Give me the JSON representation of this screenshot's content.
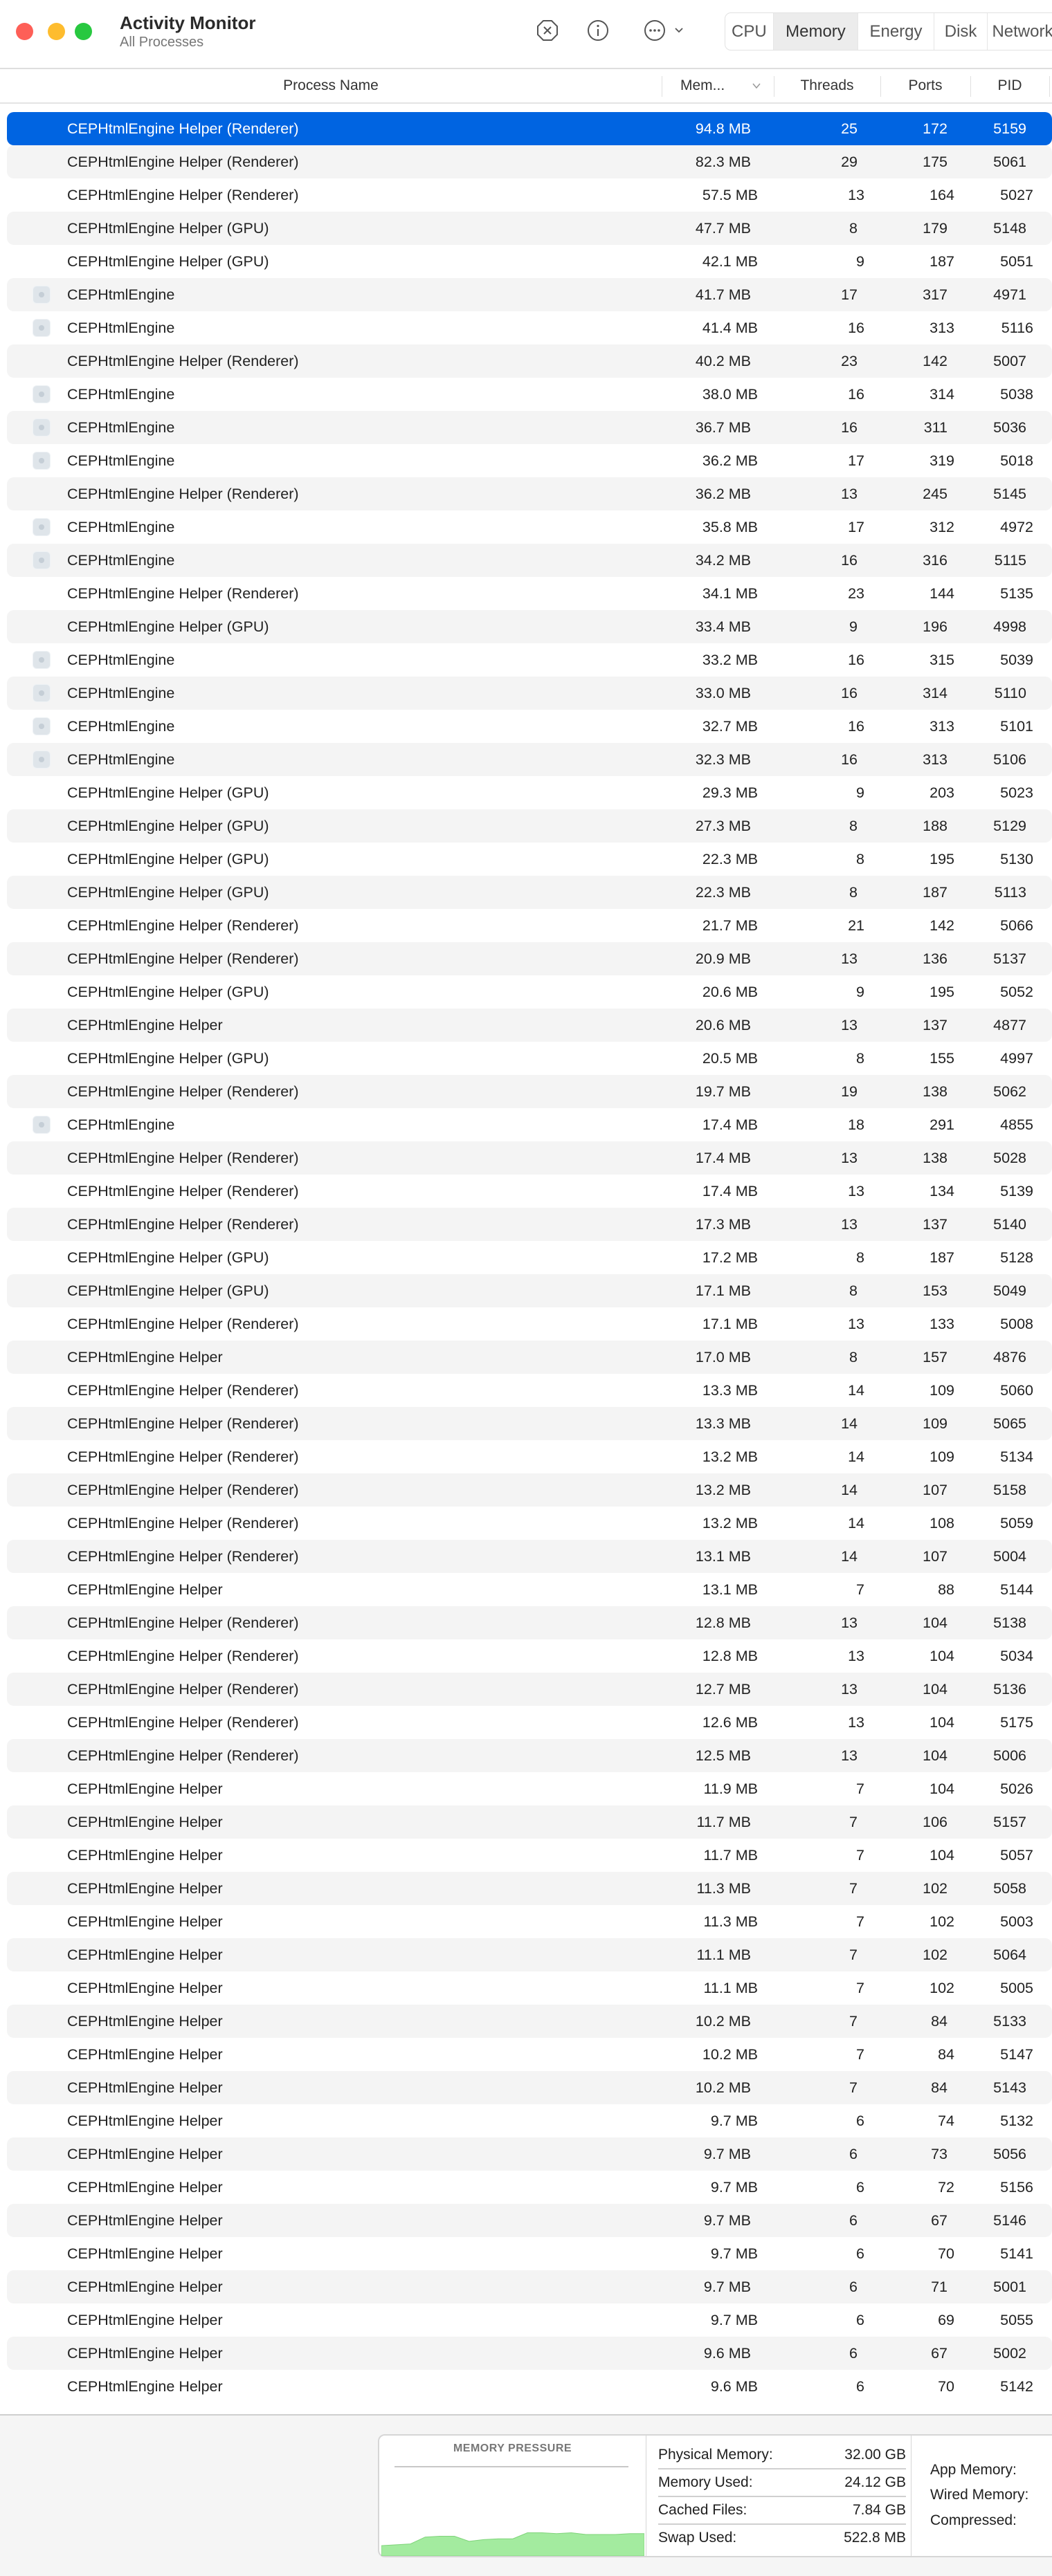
{
  "window": {
    "title": "Activity Monitor",
    "subtitle": "All Processes"
  },
  "traffic_lights": {
    "close": "#fe5f57",
    "minimize": "#febc2e",
    "zoom": "#28c840"
  },
  "toolbar": {
    "icons": [
      "stop-process-icon",
      "info-icon",
      "more-actions-icon",
      "chevron-down-icon"
    ],
    "tabs": [
      {
        "label": "CPU",
        "active": false
      },
      {
        "label": "Memory",
        "active": true
      },
      {
        "label": "Energy",
        "active": false
      },
      {
        "label": "Disk",
        "active": false
      },
      {
        "label": "Network",
        "active": false
      }
    ]
  },
  "table": {
    "columns": {
      "name": "Process Name",
      "memory": "Mem...",
      "threads": "Threads",
      "ports": "Ports",
      "pid": "PID"
    },
    "sort_column": "memory",
    "sort_direction": "descending",
    "selected_color": "#0064e1",
    "rows": [
      {
        "name": "CEPHtmlEngine Helper (Renderer)",
        "memory": "94.8 MB",
        "threads": "25",
        "ports": "172",
        "pid": "5159",
        "selected": true
      },
      {
        "name": "CEPHtmlEngine Helper (Renderer)",
        "memory": "82.3 MB",
        "threads": "29",
        "ports": "175",
        "pid": "5061"
      },
      {
        "name": "CEPHtmlEngine Helper (Renderer)",
        "memory": "57.5 MB",
        "threads": "13",
        "ports": "164",
        "pid": "5027"
      },
      {
        "name": "CEPHtmlEngine Helper (GPU)",
        "memory": "47.7 MB",
        "threads": "8",
        "ports": "179",
        "pid": "5148"
      },
      {
        "name": "CEPHtmlEngine Helper (GPU)",
        "memory": "42.1 MB",
        "threads": "9",
        "ports": "187",
        "pid": "5051"
      },
      {
        "name": "CEPHtmlEngine",
        "memory": "41.7 MB",
        "threads": "17",
        "ports": "317",
        "pid": "4971",
        "icon": "app-icon"
      },
      {
        "name": "CEPHtmlEngine",
        "memory": "41.4 MB",
        "threads": "16",
        "ports": "313",
        "pid": "5116",
        "icon": "app-icon"
      },
      {
        "name": "CEPHtmlEngine Helper (Renderer)",
        "memory": "40.2 MB",
        "threads": "23",
        "ports": "142",
        "pid": "5007"
      },
      {
        "name": "CEPHtmlEngine",
        "memory": "38.0 MB",
        "threads": "16",
        "ports": "314",
        "pid": "5038",
        "icon": "app-icon"
      },
      {
        "name": "CEPHtmlEngine",
        "memory": "36.7 MB",
        "threads": "16",
        "ports": "311",
        "pid": "5036",
        "icon": "app-icon"
      },
      {
        "name": "CEPHtmlEngine",
        "memory": "36.2 MB",
        "threads": "17",
        "ports": "319",
        "pid": "5018",
        "icon": "app-icon"
      },
      {
        "name": "CEPHtmlEngine Helper (Renderer)",
        "memory": "36.2 MB",
        "threads": "13",
        "ports": "245",
        "pid": "5145"
      },
      {
        "name": "CEPHtmlEngine",
        "memory": "35.8 MB",
        "threads": "17",
        "ports": "312",
        "pid": "4972",
        "icon": "app-icon"
      },
      {
        "name": "CEPHtmlEngine",
        "memory": "34.2 MB",
        "threads": "16",
        "ports": "316",
        "pid": "5115",
        "icon": "app-icon"
      },
      {
        "name": "CEPHtmlEngine Helper (Renderer)",
        "memory": "34.1 MB",
        "threads": "23",
        "ports": "144",
        "pid": "5135"
      },
      {
        "name": "CEPHtmlEngine Helper (GPU)",
        "memory": "33.4 MB",
        "threads": "9",
        "ports": "196",
        "pid": "4998"
      },
      {
        "name": "CEPHtmlEngine",
        "memory": "33.2 MB",
        "threads": "16",
        "ports": "315",
        "pid": "5039",
        "icon": "app-icon"
      },
      {
        "name": "CEPHtmlEngine",
        "memory": "33.0 MB",
        "threads": "16",
        "ports": "314",
        "pid": "5110",
        "icon": "app-icon"
      },
      {
        "name": "CEPHtmlEngine",
        "memory": "32.7 MB",
        "threads": "16",
        "ports": "313",
        "pid": "5101",
        "icon": "app-icon"
      },
      {
        "name": "CEPHtmlEngine",
        "memory": "32.3 MB",
        "threads": "16",
        "ports": "313",
        "pid": "5106",
        "icon": "app-icon"
      },
      {
        "name": "CEPHtmlEngine Helper (GPU)",
        "memory": "29.3 MB",
        "threads": "9",
        "ports": "203",
        "pid": "5023"
      },
      {
        "name": "CEPHtmlEngine Helper (GPU)",
        "memory": "27.3 MB",
        "threads": "8",
        "ports": "188",
        "pid": "5129"
      },
      {
        "name": "CEPHtmlEngine Helper (GPU)",
        "memory": "22.3 MB",
        "threads": "8",
        "ports": "195",
        "pid": "5130"
      },
      {
        "name": "CEPHtmlEngine Helper (GPU)",
        "memory": "22.3 MB",
        "threads": "8",
        "ports": "187",
        "pid": "5113"
      },
      {
        "name": "CEPHtmlEngine Helper (Renderer)",
        "memory": "21.7 MB",
        "threads": "21",
        "ports": "142",
        "pid": "5066"
      },
      {
        "name": "CEPHtmlEngine Helper (Renderer)",
        "memory": "20.9 MB",
        "threads": "13",
        "ports": "136",
        "pid": "5137"
      },
      {
        "name": "CEPHtmlEngine Helper (GPU)",
        "memory": "20.6 MB",
        "threads": "9",
        "ports": "195",
        "pid": "5052"
      },
      {
        "name": "CEPHtmlEngine Helper",
        "memory": "20.6 MB",
        "threads": "13",
        "ports": "137",
        "pid": "4877"
      },
      {
        "name": "CEPHtmlEngine Helper (GPU)",
        "memory": "20.5 MB",
        "threads": "8",
        "ports": "155",
        "pid": "4997"
      },
      {
        "name": "CEPHtmlEngine Helper (Renderer)",
        "memory": "19.7 MB",
        "threads": "19",
        "ports": "138",
        "pid": "5062"
      },
      {
        "name": "CEPHtmlEngine",
        "memory": "17.4 MB",
        "threads": "18",
        "ports": "291",
        "pid": "4855",
        "icon": "app-icon"
      },
      {
        "name": "CEPHtmlEngine Helper (Renderer)",
        "memory": "17.4 MB",
        "threads": "13",
        "ports": "138",
        "pid": "5028"
      },
      {
        "name": "CEPHtmlEngine Helper (Renderer)",
        "memory": "17.4 MB",
        "threads": "13",
        "ports": "134",
        "pid": "5139"
      },
      {
        "name": "CEPHtmlEngine Helper (Renderer)",
        "memory": "17.3 MB",
        "threads": "13",
        "ports": "137",
        "pid": "5140"
      },
      {
        "name": "CEPHtmlEngine Helper (GPU)",
        "memory": "17.2 MB",
        "threads": "8",
        "ports": "187",
        "pid": "5128"
      },
      {
        "name": "CEPHtmlEngine Helper (GPU)",
        "memory": "17.1 MB",
        "threads": "8",
        "ports": "153",
        "pid": "5049"
      },
      {
        "name": "CEPHtmlEngine Helper (Renderer)",
        "memory": "17.1 MB",
        "threads": "13",
        "ports": "133",
        "pid": "5008"
      },
      {
        "name": "CEPHtmlEngine Helper",
        "memory": "17.0 MB",
        "threads": "8",
        "ports": "157",
        "pid": "4876"
      },
      {
        "name": "CEPHtmlEngine Helper (Renderer)",
        "memory": "13.3 MB",
        "threads": "14",
        "ports": "109",
        "pid": "5060"
      },
      {
        "name": "CEPHtmlEngine Helper (Renderer)",
        "memory": "13.3 MB",
        "threads": "14",
        "ports": "109",
        "pid": "5065"
      },
      {
        "name": "CEPHtmlEngine Helper (Renderer)",
        "memory": "13.2 MB",
        "threads": "14",
        "ports": "109",
        "pid": "5134"
      },
      {
        "name": "CEPHtmlEngine Helper (Renderer)",
        "memory": "13.2 MB",
        "threads": "14",
        "ports": "107",
        "pid": "5158"
      },
      {
        "name": "CEPHtmlEngine Helper (Renderer)",
        "memory": "13.2 MB",
        "threads": "14",
        "ports": "108",
        "pid": "5059"
      },
      {
        "name": "CEPHtmlEngine Helper (Renderer)",
        "memory": "13.1 MB",
        "threads": "14",
        "ports": "107",
        "pid": "5004"
      },
      {
        "name": "CEPHtmlEngine Helper",
        "memory": "13.1 MB",
        "threads": "7",
        "ports": "88",
        "pid": "5144"
      },
      {
        "name": "CEPHtmlEngine Helper (Renderer)",
        "memory": "12.8 MB",
        "threads": "13",
        "ports": "104",
        "pid": "5138"
      },
      {
        "name": "CEPHtmlEngine Helper (Renderer)",
        "memory": "12.8 MB",
        "threads": "13",
        "ports": "104",
        "pid": "5034"
      },
      {
        "name": "CEPHtmlEngine Helper (Renderer)",
        "memory": "12.7 MB",
        "threads": "13",
        "ports": "104",
        "pid": "5136"
      },
      {
        "name": "CEPHtmlEngine Helper (Renderer)",
        "memory": "12.6 MB",
        "threads": "13",
        "ports": "104",
        "pid": "5175"
      },
      {
        "name": "CEPHtmlEngine Helper (Renderer)",
        "memory": "12.5 MB",
        "threads": "13",
        "ports": "104",
        "pid": "5006"
      },
      {
        "name": "CEPHtmlEngine Helper",
        "memory": "11.9 MB",
        "threads": "7",
        "ports": "104",
        "pid": "5026"
      },
      {
        "name": "CEPHtmlEngine Helper",
        "memory": "11.7 MB",
        "threads": "7",
        "ports": "106",
        "pid": "5157"
      },
      {
        "name": "CEPHtmlEngine Helper",
        "memory": "11.7 MB",
        "threads": "7",
        "ports": "104",
        "pid": "5057"
      },
      {
        "name": "CEPHtmlEngine Helper",
        "memory": "11.3 MB",
        "threads": "7",
        "ports": "102",
        "pid": "5058"
      },
      {
        "name": "CEPHtmlEngine Helper",
        "memory": "11.3 MB",
        "threads": "7",
        "ports": "102",
        "pid": "5003"
      },
      {
        "name": "CEPHtmlEngine Helper",
        "memory": "11.1 MB",
        "threads": "7",
        "ports": "102",
        "pid": "5064"
      },
      {
        "name": "CEPHtmlEngine Helper",
        "memory": "11.1 MB",
        "threads": "7",
        "ports": "102",
        "pid": "5005"
      },
      {
        "name": "CEPHtmlEngine Helper",
        "memory": "10.2 MB",
        "threads": "7",
        "ports": "84",
        "pid": "5133"
      },
      {
        "name": "CEPHtmlEngine Helper",
        "memory": "10.2 MB",
        "threads": "7",
        "ports": "84",
        "pid": "5147"
      },
      {
        "name": "CEPHtmlEngine Helper",
        "memory": "10.2 MB",
        "threads": "7",
        "ports": "84",
        "pid": "5143"
      },
      {
        "name": "CEPHtmlEngine Helper",
        "memory": "9.7 MB",
        "threads": "6",
        "ports": "74",
        "pid": "5132"
      },
      {
        "name": "CEPHtmlEngine Helper",
        "memory": "9.7 MB",
        "threads": "6",
        "ports": "73",
        "pid": "5056"
      },
      {
        "name": "CEPHtmlEngine Helper",
        "memory": "9.7 MB",
        "threads": "6",
        "ports": "72",
        "pid": "5156"
      },
      {
        "name": "CEPHtmlEngine Helper",
        "memory": "9.7 MB",
        "threads": "6",
        "ports": "67",
        "pid": "5146"
      },
      {
        "name": "CEPHtmlEngine Helper",
        "memory": "9.7 MB",
        "threads": "6",
        "ports": "70",
        "pid": "5141"
      },
      {
        "name": "CEPHtmlEngine Helper",
        "memory": "9.7 MB",
        "threads": "6",
        "ports": "71",
        "pid": "5001"
      },
      {
        "name": "CEPHtmlEngine Helper",
        "memory": "9.7 MB",
        "threads": "6",
        "ports": "69",
        "pid": "5055"
      },
      {
        "name": "CEPHtmlEngine Helper",
        "memory": "9.6 MB",
        "threads": "6",
        "ports": "67",
        "pid": "5002"
      },
      {
        "name": "CEPHtmlEngine Helper",
        "memory": "9.6 MB",
        "threads": "6",
        "ports": "70",
        "pid": "5142"
      }
    ]
  },
  "memory_pressure": {
    "title": "MEMORY PRESSURE",
    "color": "#a3eb9f",
    "history": [
      0.12,
      0.13,
      0.14,
      0.22,
      0.23,
      0.23,
      0.17,
      0.19,
      0.2,
      0.2,
      0.27,
      0.27,
      0.26,
      0.27,
      0.25,
      0.25,
      0.25,
      0.26,
      0.26
    ]
  },
  "stats": [
    {
      "label": "Physical Memory:",
      "value": "32.00 GB"
    },
    {
      "label": "Memory Used:",
      "value": "24.12 GB"
    },
    {
      "label": "Cached Files:",
      "value": "7.84 GB"
    },
    {
      "label": "Swap Used:",
      "value": "522.8 MB"
    }
  ],
  "breakdown": [
    {
      "label": "App Memory:"
    },
    {
      "label": "Wired Memory:"
    },
    {
      "label": "Compressed:"
    }
  ]
}
